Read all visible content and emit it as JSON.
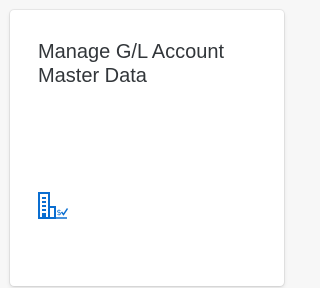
{
  "tile": {
    "title": "Manage G/L Account Master Data",
    "icon": "building-finance-icon",
    "icon_color": "#0a6ed1",
    "title_color": "#32363a",
    "background": "#ffffff"
  }
}
